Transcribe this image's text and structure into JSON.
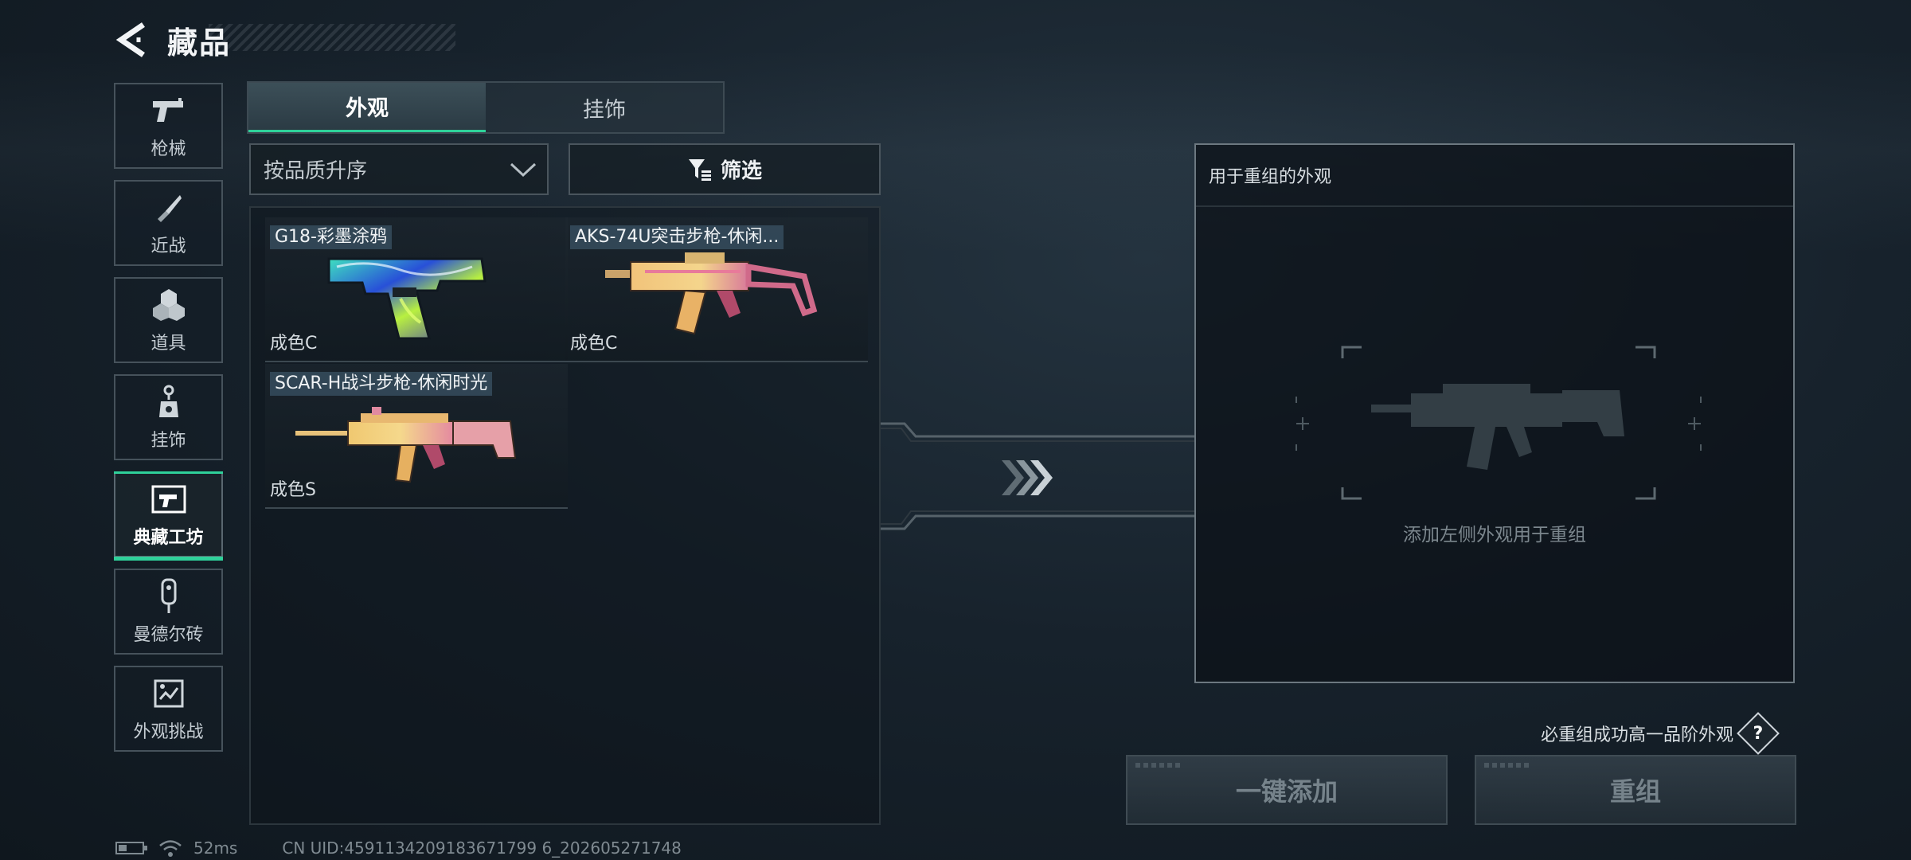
{
  "header": {
    "title": "藏品"
  },
  "sidebar": {
    "items": [
      {
        "label": "枪械",
        "icon": "pistol-icon"
      },
      {
        "label": "近战",
        "icon": "knife-icon"
      },
      {
        "label": "道具",
        "icon": "grenade-icon"
      },
      {
        "label": "挂饰",
        "icon": "charm-icon"
      },
      {
        "label": "典藏工坊",
        "icon": "workshop-icon",
        "active": true
      },
      {
        "label": "曼德尔砖",
        "icon": "brick-icon"
      },
      {
        "label": "外观挑战",
        "icon": "challenge-icon"
      }
    ]
  },
  "tabs": [
    {
      "label": "外观",
      "active": true
    },
    {
      "label": "挂饰",
      "active": false
    }
  ],
  "sort": {
    "value": "按品质升序"
  },
  "filter": {
    "label": "筛选"
  },
  "items": [
    {
      "name": "G18-彩墨涂鸦",
      "grade": "成色C"
    },
    {
      "name": "AKS-74U突击步枪-休闲...",
      "grade": "成色C"
    },
    {
      "name": "SCAR-H战斗步枪-休闲时光",
      "grade": "成色S"
    }
  ],
  "remix": {
    "title": "用于重组的外观",
    "hint": "添加左侧外观用于重组",
    "note": "必重组成功高一品阶外观",
    "help": "?",
    "add_all": "一键添加",
    "remix_btn": "重组"
  },
  "status": {
    "ping": "52ms",
    "uid": "CN UID:4591134209183671799 6_202605271748"
  },
  "colors": {
    "accent": "#2fd19a",
    "panel_border": "#6c7880"
  }
}
